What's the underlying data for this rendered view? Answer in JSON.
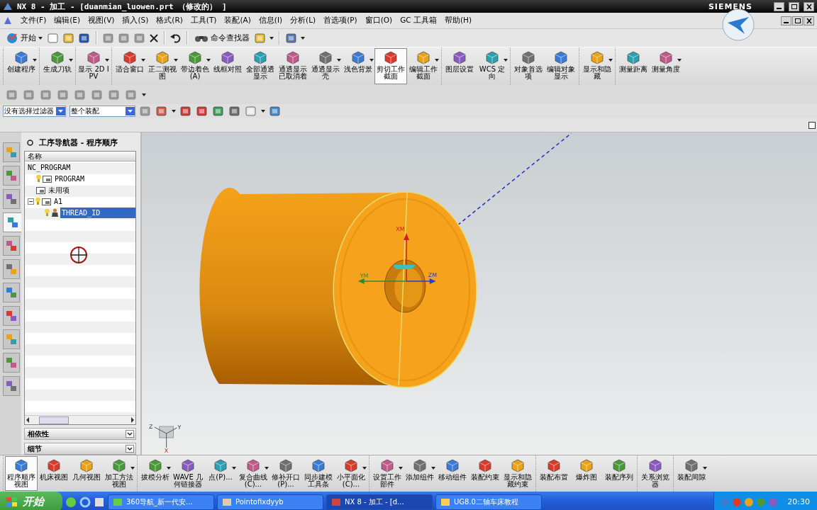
{
  "window": {
    "title": "NX 8 - 加工 - [duanmian_luowen.prt （修改的） ]",
    "brand": "SIEMENS"
  },
  "menu": [
    "文件(F)",
    "编辑(E)",
    "视图(V)",
    "插入(S)",
    "格式(R)",
    "工具(T)",
    "装配(A)",
    "信息(I)",
    "分析(L)",
    "首选项(P)",
    "窗口(O)",
    "GC 工具箱",
    "帮助(H)"
  ],
  "standard_toolbar": {
    "start_label": "开始",
    "finder_label": "命令查找器"
  },
  "main_toolbar": {
    "groups": [
      [
        {
          "label": "创建程序",
          "selected": false,
          "has_menu": true
        }
      ],
      [
        {
          "label": "生成刀轨",
          "selected": false,
          "has_menu": true
        }
      ],
      [
        {
          "label": "显示 2D IPV",
          "selected": false,
          "has_menu": true
        }
      ],
      [
        {
          "label": "适合窗口",
          "selected": false,
          "has_menu": true
        },
        {
          "label": "正二测视图",
          "selected": false,
          "has_menu": true
        },
        {
          "label": "带边着色(A)",
          "selected": false,
          "has_menu": true
        },
        {
          "label": "线框对照",
          "selected": false,
          "has_menu": false
        },
        {
          "label": "全部通透显示",
          "selected": false,
          "has_menu": false
        },
        {
          "label": "通透显示已取消着",
          "selected": false,
          "has_menu": false
        },
        {
          "label": "通透显示壳",
          "selected": false,
          "has_menu": true
        },
        {
          "label": "浅色背景",
          "selected": false,
          "has_menu": true
        },
        {
          "label": "剪切工作截面",
          "selected": true,
          "has_menu": false
        },
        {
          "label": "编辑工作截面",
          "selected": false,
          "has_menu": true
        }
      ],
      [
        {
          "label": "图层设置",
          "selected": false,
          "has_menu": false
        },
        {
          "label": "WCS 定向",
          "selected": false,
          "has_menu": true
        }
      ],
      [
        {
          "label": "对象首选项",
          "selected": false,
          "has_menu": false
        },
        {
          "label": "编辑对象显示",
          "selected": false,
          "has_menu": false
        }
      ],
      [
        {
          "label": "显示和隐藏",
          "selected": false,
          "has_menu": true
        }
      ],
      [
        {
          "label": "测量距离",
          "selected": false,
          "has_menu": false
        },
        {
          "label": "测量角度",
          "selected": false,
          "has_menu": true
        }
      ]
    ]
  },
  "filter_bar": {
    "type_filter": "没有选择过滤器",
    "scope": "整个装配"
  },
  "resource_tabs": [
    {
      "selected": false
    },
    {
      "selected": false
    },
    {
      "selected": false
    },
    {
      "selected": true
    },
    {
      "selected": false
    },
    {
      "selected": false
    },
    {
      "selected": false
    },
    {
      "selected": false
    },
    {
      "selected": false
    },
    {
      "selected": false
    },
    {
      "selected": false
    }
  ],
  "navigator": {
    "title": "工序导航器 - 程序顺序",
    "column": "名称",
    "tree": [
      {
        "label": "NC_PROGRAM",
        "selected": false,
        "children": [
          {
            "label": "PROGRAM",
            "kind": "program",
            "selected": false
          },
          {
            "label": "未用项",
            "kind": "unused",
            "selected": false
          },
          {
            "label": "A1",
            "kind": "program",
            "selected": false,
            "expanded": true,
            "children": [
              {
                "label": "THREAD_ID",
                "kind": "operation",
                "selected": true
              }
            ]
          }
        ]
      }
    ],
    "sections": [
      {
        "label": "相依性",
        "expanded": false
      },
      {
        "label": "细节",
        "expanded": false
      }
    ]
  },
  "viewport": {
    "axis_labels": [
      "XM",
      "YM",
      "ZM"
    ],
    "triad_labels": [
      "Z",
      "Y",
      "X"
    ]
  },
  "bottom_toolbar": {
    "groups": [
      [
        {
          "label": "程序顺序视图",
          "selected": true,
          "has_menu": false
        },
        {
          "label": "机床视图",
          "selected": false,
          "has_menu": false
        },
        {
          "label": "几何视图",
          "selected": false,
          "has_menu": false
        },
        {
          "label": "加工方法视图",
          "selected": false,
          "has_menu": true
        }
      ],
      [
        {
          "label": "拔模分析",
          "selected": false,
          "has_menu": true
        },
        {
          "label": "WAVE 几何链接器",
          "selected": false,
          "has_menu": false
        },
        {
          "label": "点(P)...",
          "selected": false,
          "has_menu": true
        },
        {
          "label": "复合曲线(C)...",
          "selected": false,
          "has_menu": true
        },
        {
          "label": "修补开口(P)...",
          "selected": false,
          "has_menu": false
        },
        {
          "label": "同步建模工具条",
          "selected": false,
          "has_menu": false
        },
        {
          "label": "小平面化(C)...",
          "selected": false,
          "has_menu": true
        }
      ],
      [
        {
          "label": "设置工作部件",
          "selected": false,
          "has_menu": true
        },
        {
          "label": "添加组件",
          "selected": false,
          "has_menu": true
        },
        {
          "label": "移动组件",
          "selected": false,
          "has_menu": false
        },
        {
          "label": "装配约束",
          "selected": false,
          "has_menu": false
        },
        {
          "label": "显示和隐藏约束",
          "selected": false,
          "has_menu": false
        }
      ],
      [
        {
          "label": "装配布置",
          "selected": false,
          "has_menu": false
        },
        {
          "label": "爆炸图",
          "selected": false,
          "has_menu": false
        },
        {
          "label": "装配序列",
          "selected": false,
          "has_menu": false
        }
      ],
      [
        {
          "label": "关系浏览器",
          "selected": false,
          "has_menu": false
        }
      ],
      [
        {
          "label": "装配间隙",
          "selected": false,
          "has_menu": true
        }
      ]
    ]
  },
  "taskbar": {
    "start": "开始",
    "tasks": [
      {
        "label": "360导航_新一代安...",
        "selected": false
      },
      {
        "label": "Pointofixdyyb",
        "selected": false
      },
      {
        "label": "NX 8 - 加工 - [d...",
        "selected": true
      },
      {
        "label": "UG8.0二轴车床教程",
        "selected": false
      }
    ],
    "clock": "20:30"
  }
}
